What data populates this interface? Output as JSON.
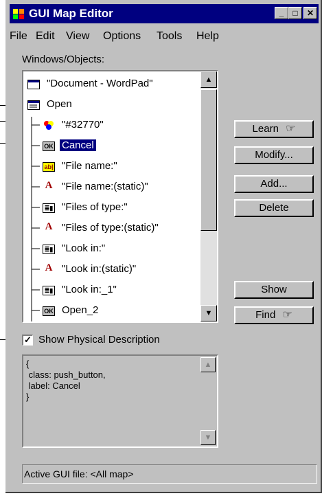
{
  "window": {
    "title": "GUI Map Editor"
  },
  "title_buttons": {
    "minimize": "_",
    "maximize": "□",
    "close": "✕"
  },
  "menu": {
    "file": "File",
    "edit": "Edit",
    "view": "View",
    "options": "Options",
    "tools": "Tools",
    "help": "Help"
  },
  "objects_label": "Windows/Objects:",
  "tree": {
    "items": [
      {
        "label": "\"Document - WordPad\"",
        "icon": "window-icon"
      },
      {
        "label": "Open",
        "icon": "window-icon"
      },
      {
        "label": "\"#32770\"",
        "icon": "object-icon"
      },
      {
        "label": "Cancel",
        "icon": "push-button-icon",
        "selected": true
      },
      {
        "label": "\"File name:\"",
        "icon": "edit-field-icon"
      },
      {
        "label": "\"File name:(static)\"",
        "icon": "static-text-icon"
      },
      {
        "label": "\"Files of type:\"",
        "icon": "list-icon"
      },
      {
        "label": "\"Files of type:(static)\"",
        "icon": "static-text-icon"
      },
      {
        "label": "\"Look in:\"",
        "icon": "list-icon"
      },
      {
        "label": "\"Look in:(static)\"",
        "icon": "static-text-icon"
      },
      {
        "label": "\"Look in:_1\"",
        "icon": "list-icon"
      },
      {
        "label": "Open_2",
        "icon": "push-button-icon"
      }
    ]
  },
  "buttons": {
    "learn": "Learn",
    "modify": "Modify...",
    "add": "Add...",
    "delete": "Delete",
    "show": "Show",
    "find": "Find"
  },
  "physical": {
    "label": "Show Physical Description",
    "checked": true,
    "description": "{\n class: push_button,\n label: Cancel\n}"
  },
  "status": "Active GUI file: <All map>"
}
